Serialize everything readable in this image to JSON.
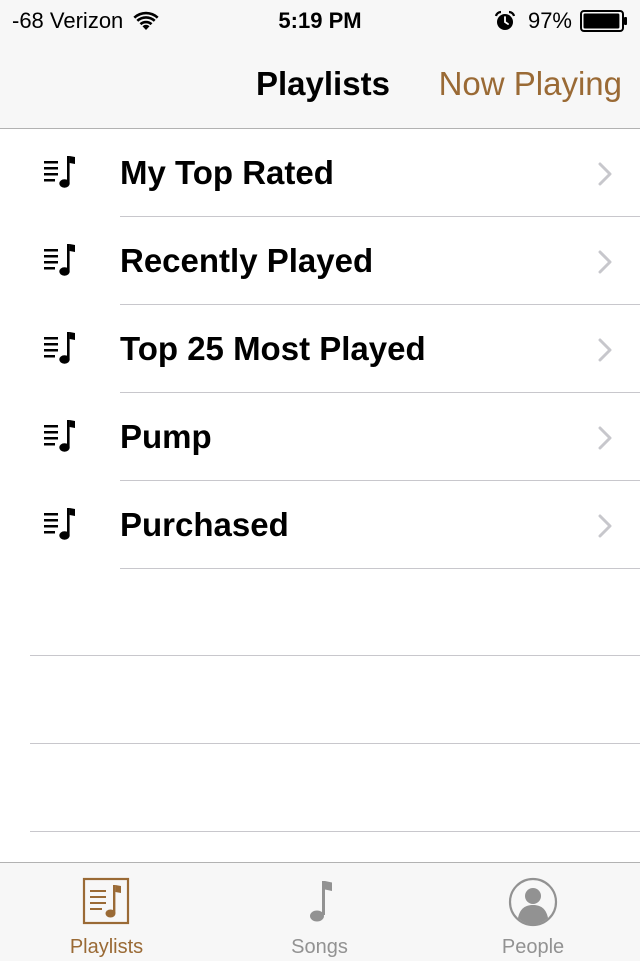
{
  "status_bar": {
    "carrier": "-68 Verizon",
    "time": "5:19 PM",
    "battery_percent": "97%",
    "wifi_icon": "wifi-icon",
    "alarm_icon": "alarm-icon",
    "battery_icon": "battery-icon",
    "battery_level": 0.97
  },
  "nav": {
    "title": "Playlists",
    "now_playing": "Now Playing"
  },
  "playlists": [
    {
      "label": "My Top Rated",
      "icon": "playlist-icon"
    },
    {
      "label": "Recently Played",
      "icon": "playlist-icon"
    },
    {
      "label": "Top 25 Most Played",
      "icon": "playlist-icon"
    },
    {
      "label": "Pump",
      "icon": "playlist-icon"
    },
    {
      "label": "Purchased",
      "icon": "playlist-icon"
    }
  ],
  "tabs": [
    {
      "label": "Playlists",
      "icon": "playlists-tab-icon",
      "selected": true
    },
    {
      "label": "Songs",
      "icon": "songs-tab-icon",
      "selected": false
    },
    {
      "label": "People",
      "icon": "people-tab-icon",
      "selected": false
    }
  ],
  "colors": {
    "accent": "#9a6a35",
    "inactive": "#929292",
    "bar_background": "#f7f7f7",
    "separator": "#c8c7cc"
  }
}
